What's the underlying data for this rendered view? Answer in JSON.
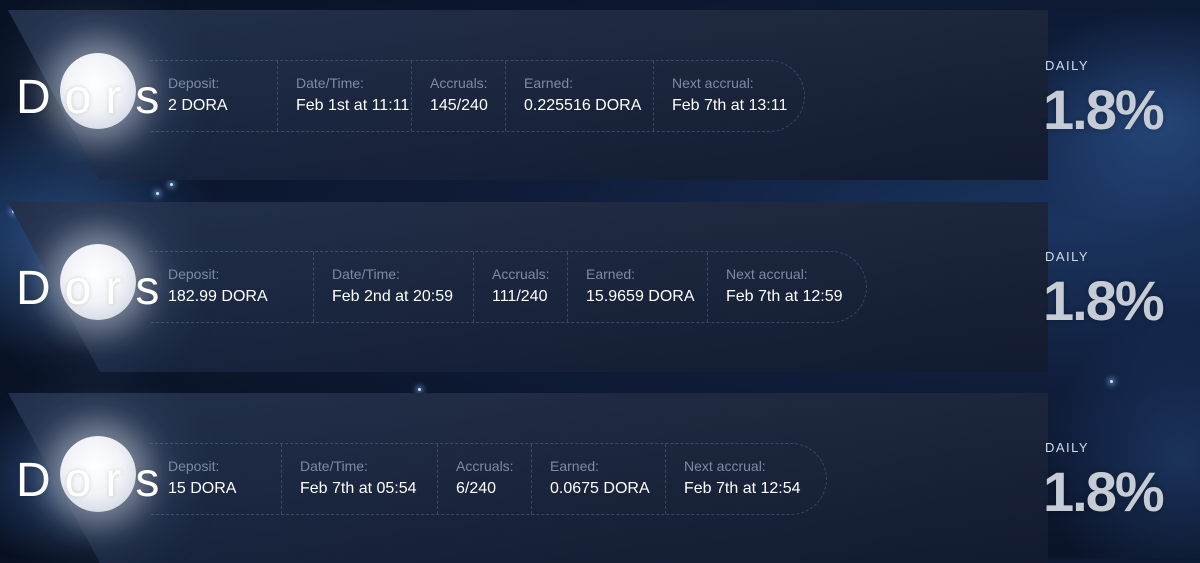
{
  "investments": [
    {
      "brand": "Dors",
      "deposit_label": "Deposit:",
      "deposit": "2 DORA",
      "datetime_label": "Date/Time:",
      "datetime": "Feb 1st at 11:11",
      "accruals_label": "Accruals:",
      "accruals": "145/240",
      "earned_label": "Earned:",
      "earned": "0.225516 DORA",
      "next_label": "Next accrual:",
      "next": "Feb 7th at 13:11",
      "rate_label": "DAILY",
      "rate": "1.8%"
    },
    {
      "brand": "Dors",
      "deposit_label": "Deposit:",
      "deposit": "182.99 DORA",
      "datetime_label": "Date/Time:",
      "datetime": "Feb 2nd at 20:59",
      "accruals_label": "Accruals:",
      "accruals": "111/240",
      "earned_label": "Earned:",
      "earned": "15.9659 DORA",
      "next_label": "Next accrual:",
      "next": "Feb 7th at 12:59",
      "rate_label": "DAILY",
      "rate": "1.8%"
    },
    {
      "brand": "Dors",
      "deposit_label": "Deposit:",
      "deposit": "15 DORA",
      "datetime_label": "Date/Time:",
      "datetime": "Feb 7th at 05:54",
      "accruals_label": "Accruals:",
      "accruals": "6/240",
      "earned_label": "Earned:",
      "earned": "0.0675 DORA",
      "next_label": "Next accrual:",
      "next": "Feb 7th at 12:54",
      "rate_label": "DAILY",
      "rate": "1.8%"
    }
  ],
  "colors": {
    "label": "#7d8aa3",
    "value": "#ffffff",
    "rate": "#c6ccd6",
    "card": "#17233c"
  },
  "icons": {
    "logo": "moon-icon"
  }
}
